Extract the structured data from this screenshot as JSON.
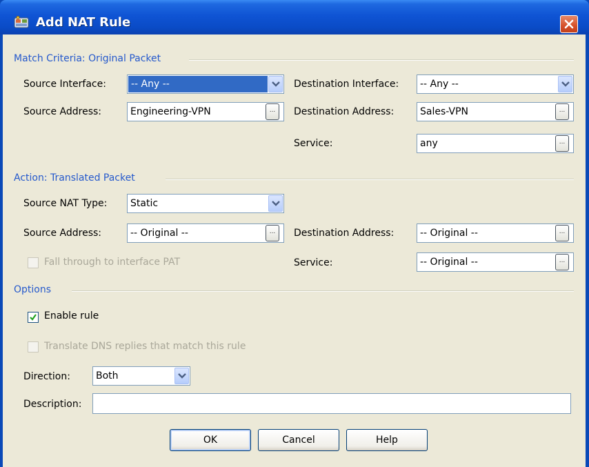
{
  "window": {
    "title": "Add NAT Rule"
  },
  "match": {
    "section_label": "Match Criteria: Original Packet",
    "source_interface_label": "Source Interface:",
    "source_interface_value": "-- Any --",
    "destination_interface_label": "Destination Interface:",
    "destination_interface_value": "-- Any --",
    "source_address_label": "Source Address:",
    "source_address_value": "Engineering-VPN",
    "destination_address_label": "Destination Address:",
    "destination_address_value": "Sales-VPN",
    "service_label": "Service:",
    "service_value": "any"
  },
  "action": {
    "section_label": "Action: Translated Packet",
    "source_nat_type_label": "Source NAT Type:",
    "source_nat_type_value": "Static",
    "source_address_label": "Source Address:",
    "source_address_value": "-- Original --",
    "destination_address_label": "Destination Address:",
    "destination_address_value": "-- Original --",
    "fall_through_label": "Fall through to interface PAT",
    "service_label": "Service:",
    "service_value": "-- Original --"
  },
  "options": {
    "section_label": "Options",
    "enable_rule_label": "Enable rule",
    "enable_rule_checked": true,
    "translate_dns_label": "Translate DNS replies that match this rule",
    "direction_label": "Direction:",
    "direction_value": "Both",
    "description_label": "Description:",
    "description_value": ""
  },
  "buttons": {
    "ok": "OK",
    "cancel": "Cancel",
    "help": "Help"
  },
  "icons": {
    "browse_glyph": "...",
    "title_icon": "app-icon",
    "close_icon": "close-icon",
    "dropdown_icon": "chevron-down-icon"
  },
  "colors": {
    "titlebar": "#0a4bc6",
    "section_text": "#2559cc",
    "selection": "#316ac5",
    "dialog_bg": "#ece9d8",
    "close_button": "#d5502a"
  }
}
